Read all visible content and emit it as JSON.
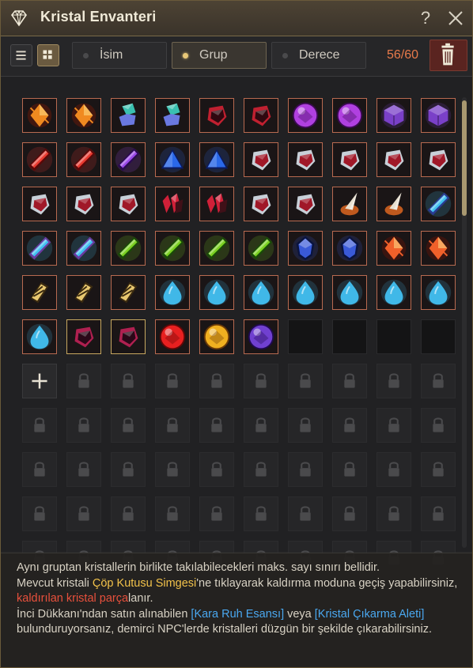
{
  "window": {
    "title": "Kristal Envanteri",
    "help_label": "?",
    "icons": {
      "title": "diamond-icon",
      "help": "question-icon",
      "close": "close-icon"
    }
  },
  "toolbar": {
    "view_list_icon": "list-icon",
    "view_grid_icon": "grid-icon",
    "filters": [
      {
        "label": "İsim",
        "active": false
      },
      {
        "label": "Grup",
        "active": true
      },
      {
        "label": "Derece",
        "active": false
      }
    ],
    "count": "56/60",
    "trash_icon": "trash-icon",
    "colors": {
      "count": "#e87a4a",
      "active_dot": "#e8c878",
      "trash_bg": "#5a2420"
    }
  },
  "inventory": {
    "items": [
      {
        "kind": "fire-shard",
        "color": "#f08a20",
        "accent": "#6a1a08"
      },
      {
        "kind": "fire-shard",
        "color": "#f08a20",
        "accent": "#6a1a08"
      },
      {
        "kind": "green-blue-ore",
        "color": "#3ac0b0",
        "accent": "#6a78e0"
      },
      {
        "kind": "green-blue-ore",
        "color": "#3ac0b0",
        "accent": "#6a78e0"
      },
      {
        "kind": "dark-red-gem",
        "color": "#c02030",
        "accent": "#300810"
      },
      {
        "kind": "dark-red-gem",
        "color": "#c02030",
        "accent": "#300810"
      },
      {
        "kind": "purple-orb",
        "color": "#b040e0",
        "accent": "#3a0a50"
      },
      {
        "kind": "purple-orb",
        "color": "#b040e0",
        "accent": "#3a0a50"
      },
      {
        "kind": "purple-hexagon",
        "color": "#7a40c8",
        "accent": "#301850"
      },
      {
        "kind": "purple-hexagon",
        "color": "#7a40c8",
        "accent": "#301850"
      },
      {
        "kind": "red-crystal",
        "color": "#e83a30",
        "accent": "#5a0808"
      },
      {
        "kind": "red-crystal",
        "color": "#e83a30",
        "accent": "#5a0808"
      },
      {
        "kind": "violet-crystal",
        "color": "#9a48e8",
        "accent": "#2a0a50"
      },
      {
        "kind": "blue-triangle",
        "color": "#2a68e8",
        "accent": "#0a1a60"
      },
      {
        "kind": "blue-triangle",
        "color": "#2a68e8",
        "accent": "#0a1a60"
      },
      {
        "kind": "silver-red-gem",
        "color": "#c8d0d8",
        "accent": "#a01828"
      },
      {
        "kind": "silver-red-gem",
        "color": "#c8d0d8",
        "accent": "#a01828"
      },
      {
        "kind": "silver-red-gem",
        "color": "#c8d0d8",
        "accent": "#a01828"
      },
      {
        "kind": "silver-red-gem",
        "color": "#c8d0d8",
        "accent": "#a01828"
      },
      {
        "kind": "silver-red-gem",
        "color": "#c8d0d8",
        "accent": "#a01828"
      },
      {
        "kind": "silver-red-gem",
        "color": "#c8d0d8",
        "accent": "#a01828"
      },
      {
        "kind": "silver-red-gem",
        "color": "#c8d0d8",
        "accent": "#a01828"
      },
      {
        "kind": "silver-red-gem",
        "color": "#c8d0d8",
        "accent": "#a01828"
      },
      {
        "kind": "red-cluster",
        "color": "#d02038",
        "accent": "#401018"
      },
      {
        "kind": "red-cluster",
        "color": "#d02038",
        "accent": "#401018"
      },
      {
        "kind": "silver-red-gem",
        "color": "#c8d0d8",
        "accent": "#a01828"
      },
      {
        "kind": "silver-red-gem",
        "color": "#c8d0d8",
        "accent": "#a01828"
      },
      {
        "kind": "spike-flame",
        "color": "#e8e0d0",
        "accent": "#e86a20"
      },
      {
        "kind": "spike-flame",
        "color": "#e8e0d0",
        "accent": "#e86a20"
      },
      {
        "kind": "cyan-prism",
        "color": "#40c0f0",
        "accent": "#2a3a90"
      },
      {
        "kind": "cyan-prism",
        "color": "#40c0f0",
        "accent": "#6a3aa0"
      },
      {
        "kind": "cyan-prism",
        "color": "#40c0f0",
        "accent": "#6a3aa0"
      },
      {
        "kind": "green-crystal",
        "color": "#7ad020",
        "accent": "#1a4a08"
      },
      {
        "kind": "green-crystal",
        "color": "#7ad020",
        "accent": "#1a4a08"
      },
      {
        "kind": "green-crystal",
        "color": "#7ad020",
        "accent": "#1a4a08"
      },
      {
        "kind": "green-crystal",
        "color": "#7ad020",
        "accent": "#1a4a08"
      },
      {
        "kind": "blue-gem",
        "color": "#3a5ad8",
        "accent": "#0a1440"
      },
      {
        "kind": "blue-gem",
        "color": "#3a5ad8",
        "accent": "#0a1440"
      },
      {
        "kind": "fire-gem",
        "color": "#f0602a",
        "accent": "#5a1408"
      },
      {
        "kind": "fire-gem",
        "color": "#f0602a",
        "accent": "#5a1408"
      },
      {
        "kind": "gold-shard",
        "color": "#e8c870",
        "accent": "#3a2a10"
      },
      {
        "kind": "gold-shard",
        "color": "#e8c870",
        "accent": "#3a2a10"
      },
      {
        "kind": "gold-shard",
        "color": "#e8c870",
        "accent": "#3a2a10"
      },
      {
        "kind": "cyan-droplet",
        "color": "#40b8e8",
        "accent": "#0a3050"
      },
      {
        "kind": "cyan-droplet",
        "color": "#40b8e8",
        "accent": "#0a3050"
      },
      {
        "kind": "cyan-droplet",
        "color": "#40b8e8",
        "accent": "#0a3050"
      },
      {
        "kind": "cyan-droplet",
        "color": "#40b8e8",
        "accent": "#0a3050"
      },
      {
        "kind": "cyan-droplet",
        "color": "#40b8e8",
        "accent": "#0a3050"
      },
      {
        "kind": "cyan-droplet",
        "color": "#40b8e8",
        "accent": "#0a3050"
      },
      {
        "kind": "cyan-droplet",
        "color": "#40b8e8",
        "accent": "#0a3050"
      },
      {
        "kind": "cyan-droplet",
        "color": "#40b8e8",
        "accent": "#0a3050"
      },
      {
        "kind": "maroon-gem",
        "color": "#b02050",
        "accent": "#2a0818",
        "frame": "gold"
      },
      {
        "kind": "maroon-gem",
        "color": "#b02050",
        "accent": "#2a0818",
        "frame": "gold"
      },
      {
        "kind": "red-orb",
        "color": "#e82020",
        "accent": "#600808"
      },
      {
        "kind": "gold-orb",
        "color": "#f0b020",
        "accent": "#6a3a08"
      },
      {
        "kind": "indigo-orb",
        "color": "#7040d0",
        "accent": "#200a50"
      }
    ],
    "empty_slots": 4,
    "add_slot_icon": "plus-icon",
    "locked_icon": "lock-icon",
    "locked_rows": 5
  },
  "info": {
    "line1": "Aynı gruptan kristallerin birlikte takılabilecekleri maks. sayı sınırı bellidir.",
    "line2_a": "Mevcut kristali ",
    "line2_b": "Çöp Kutusu Simgesi",
    "line2_c": "'ne tıklayarak kaldırma moduna geçiş yapabilirsiniz, ",
    "line2_d": "kaldırılan kristal parça",
    "line2_e": "lanır.",
    "line3_a": "İnci Dükkanı'ndan satın alınabilen ",
    "line3_b": "[Kara Ruh Esansı]",
    "line3_c": " veya ",
    "line3_d": "[Kristal Çıkarma Aleti]",
    "line3_e": " bulunduruyorsanız, demirci NPC'lerde kristalleri düzgün bir şekilde çıkarabilirsiniz.",
    "colors": {
      "yellow": "#f2c24a",
      "red": "#e8503c",
      "blue": "#4aa8f0"
    }
  }
}
